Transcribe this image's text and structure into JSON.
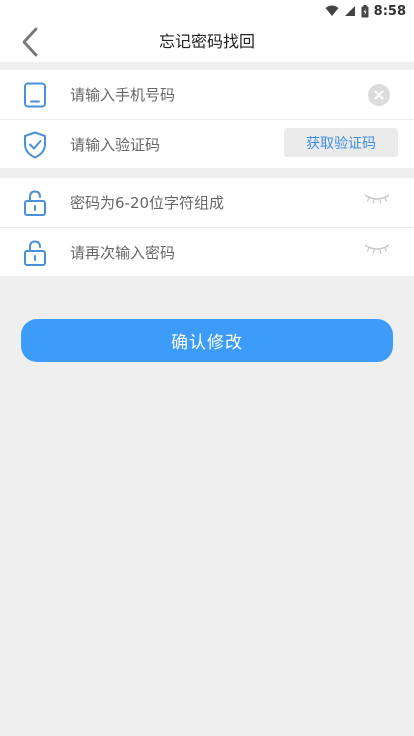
{
  "status_bar": {
    "time": "8:58",
    "icons": [
      "wifi-icon",
      "cellular-signal-icon",
      "battery-icon"
    ]
  },
  "header": {
    "title": "忘记密码找回",
    "back_icon": "chevron-left-icon"
  },
  "form": {
    "phone": {
      "placeholder": "请输入手机号码",
      "value": "",
      "icon": "tablet-icon"
    },
    "code": {
      "placeholder": "请输入验证码",
      "value": "",
      "icon": "shield-check-icon",
      "get_code_label": "获取验证码"
    },
    "password": {
      "placeholder": "密码为6-20位字符组成",
      "value": "",
      "icon": "lock-icon"
    },
    "confirm_password": {
      "placeholder": "请再次输入密码",
      "value": "",
      "icon": "lock-icon"
    }
  },
  "submit_label": "确认修改",
  "colors": {
    "accent": "#3d9bfa",
    "link": "#3d8ee0",
    "background": "#efefef",
    "icon_blue": "#4a90d9"
  }
}
